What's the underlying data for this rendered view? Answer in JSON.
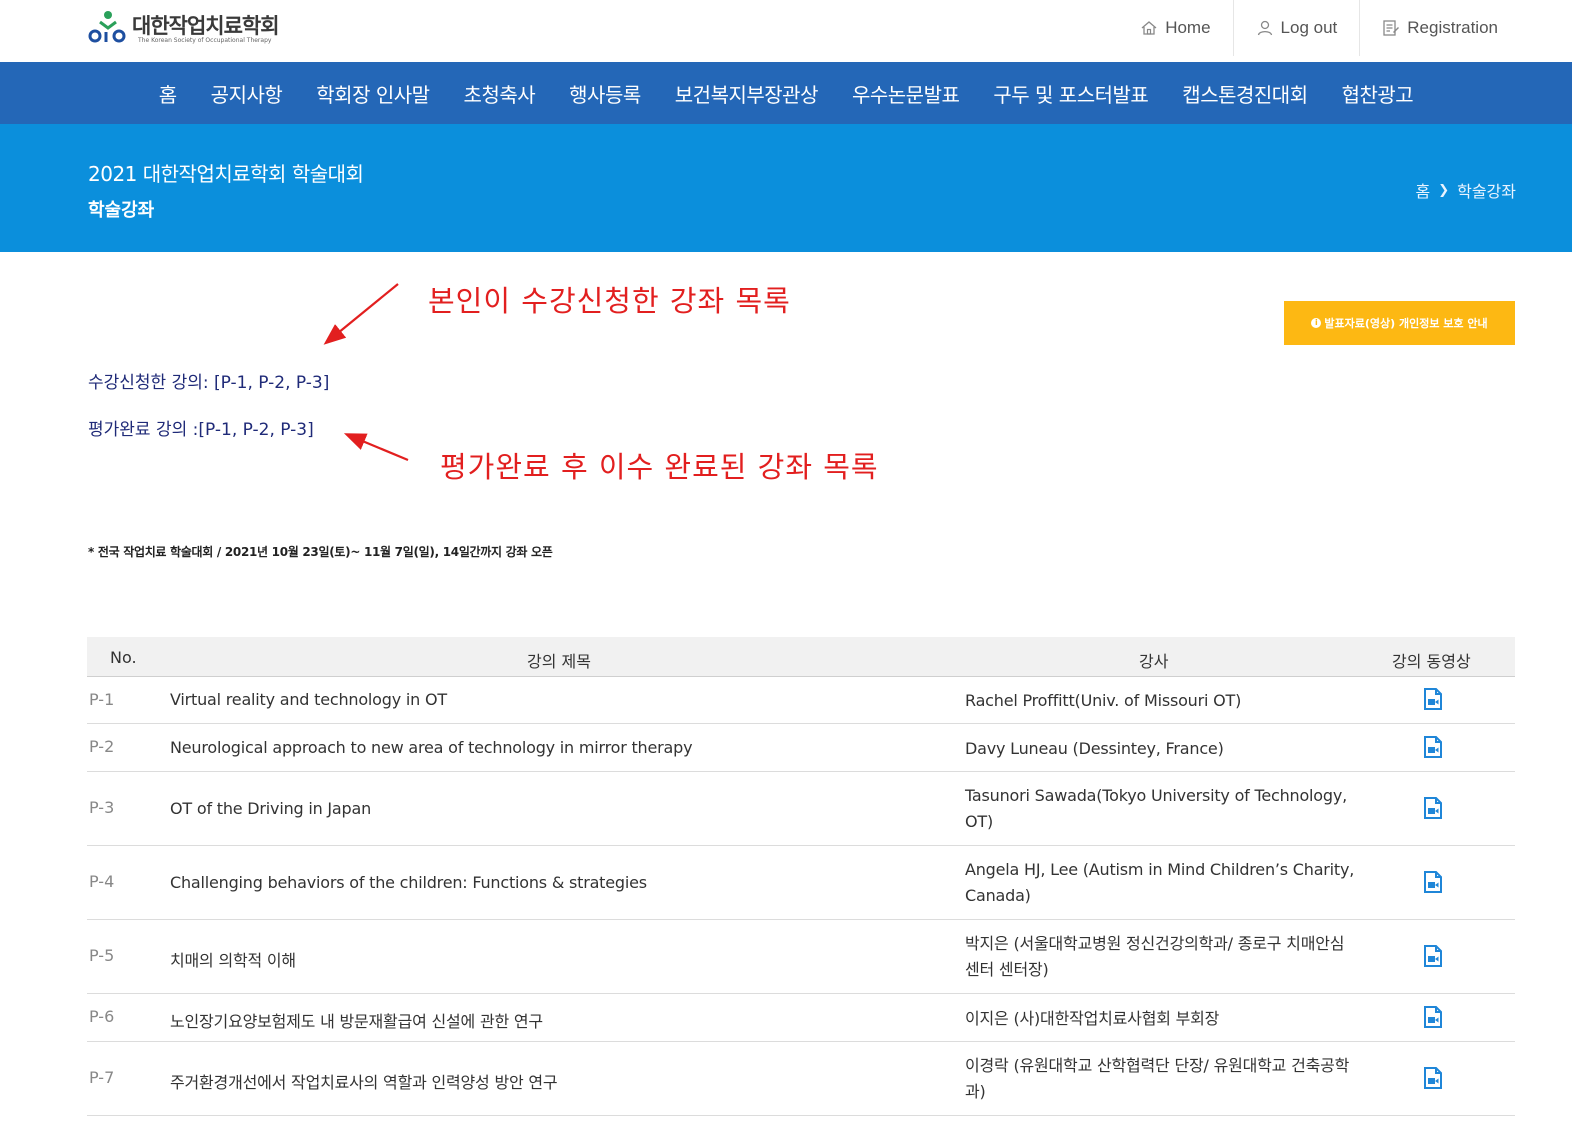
{
  "header": {
    "logo_title": "대한작업치료학회",
    "logo_subtitle": "The Korean Society of Occupational Therapy",
    "links": [
      {
        "label": "Home",
        "icon": "home-icon"
      },
      {
        "label": "Log out",
        "icon": "user-icon"
      },
      {
        "label": "Registration",
        "icon": "edit-document-icon"
      }
    ]
  },
  "nav": {
    "items": [
      "홈",
      "공지사항",
      "학회장 인사말",
      "초청축사",
      "행사등록",
      "보건복지부장관상",
      "우수논문발표",
      "구두 및 포스터발표",
      "캡스톤경진대회",
      "협찬광고"
    ]
  },
  "banner": {
    "title": "2021 대한작업치료학회 학술대회",
    "subtitle": "학술강좌",
    "breadcrumb_home": "홈",
    "breadcrumb_current": "학술강좌"
  },
  "annotations": {
    "enrolled_note": "본인이 수강신청한 강좌 목록",
    "completed_note": "평가완료 후 이수 완료된 강좌 목록"
  },
  "privacy_button": "발표자료(영상) 개인정보 보호 안내",
  "status": {
    "enrolled": "수강신청한 강의: [P-1, P-2, P-3]",
    "completed": "평가완료 강의 :[P-1, P-2, P-3]"
  },
  "schedule_note": "* 전국 작업치료 학술대회 / 2021년 10월 23일(토)~ 11월 7일(일), 14일간까지 강좌 오픈",
  "table": {
    "headers": {
      "no": "No.",
      "title": "강의 제목",
      "lecturer": "강사",
      "video": "강의 동영상"
    },
    "rows": [
      {
        "no": "P-1",
        "title": "Virtual reality and technology in OT",
        "lecturer": "Rachel Proffitt(Univ. of Missouri OT)"
      },
      {
        "no": "P-2",
        "title": "Neurological approach to new area of technology in mirror therapy",
        "lecturer": "Davy Luneau (Dessintey, France)"
      },
      {
        "no": "P-3",
        "title": "OT of the Driving in Japan",
        "lecturer": "Tasunori Sawada(Tokyo University of Technology, OT)"
      },
      {
        "no": "P-4",
        "title": "Challenging behaviors of the children: Functions & strategies",
        "lecturer": "Angela HJ, Lee (Autism in Mind Children’s Charity, Canada)"
      },
      {
        "no": "P-5",
        "title": "치매의 의학적 이해",
        "lecturer": "박지은 (서울대학교병원 정신건강의학과/ 종로구 치매안심센터 센터장)"
      },
      {
        "no": "P-6",
        "title": "노인장기요양보험제도 내 방문재활급여 신설에 관한 연구",
        "lecturer": "이지은 (사)대한작업치료사협회 부회장"
      },
      {
        "no": "P-7",
        "title": "주거환경개선에서 작업치료사의 역할과 인력양성 방안 연구",
        "lecturer": "이경락 (유원대학교 산학협력단 단장/ 유원대학교 건축공학과)"
      }
    ]
  },
  "colors": {
    "nav_bg": "#2467b7",
    "banner_bg": "#0b8fdc",
    "annotation": "#e21f1f",
    "button": "#fdb813",
    "status_text": "#1f2a78",
    "video_icon": "#1f86d8"
  }
}
